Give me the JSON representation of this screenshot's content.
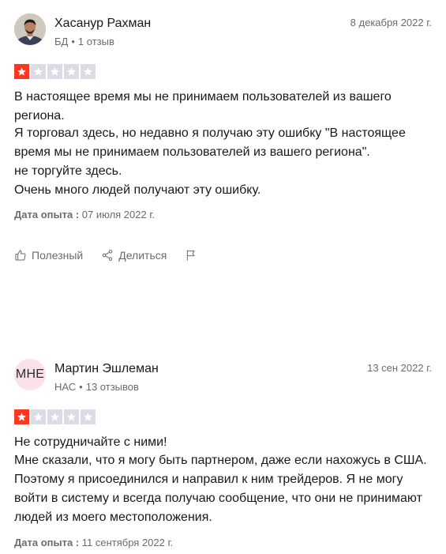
{
  "colors": {
    "star_on": "#ff3722",
    "star_off": "#dcdce6",
    "muted_text": "#6b6b6b",
    "avatar_initials_bg": "#fbe2ea"
  },
  "reviews": [
    {
      "author": "Хасанур Рахман",
      "country": "БД",
      "reviews_count": "1 отзыв",
      "date": "8 декабря 2022 г.",
      "avatar": "photo",
      "rating": 1,
      "rating_max": 5,
      "title": "В настоящее время мы не принимаем пользователей из вашего региона.",
      "body": [
        "Я торговал здесь, но недавно я получаю эту ошибку \"В настоящее время мы не принимаем пользователей из вашего региона\".",
        "не торгуйте здесь.",
        "Очень много людей получают эту ошибку."
      ],
      "experience_label": "Дата опыта :",
      "experience_date": "07 июля 2022 г.",
      "actions": {
        "useful": "Полезный",
        "share": "Делиться"
      }
    },
    {
      "author": "Мартин Эшлеман",
      "country": "НАС",
      "reviews_count": "13 отзывов",
      "date": "13 сен 2022 г.",
      "avatar": "МНЕ",
      "rating": 1,
      "rating_max": 5,
      "title": "Не сотрудничайте с ними!",
      "body": [
        "Мне сказали, что я могу быть партнером, даже если нахожусь в США. Поэтому я присоединился и направил к ним трейдеров. Я не могу войти в систему и всегда получаю сообщение, что они не принимают людей из моего местоположения."
      ],
      "experience_label": "Дата опыта :",
      "experience_date": "11 сентября 2022 г."
    }
  ]
}
